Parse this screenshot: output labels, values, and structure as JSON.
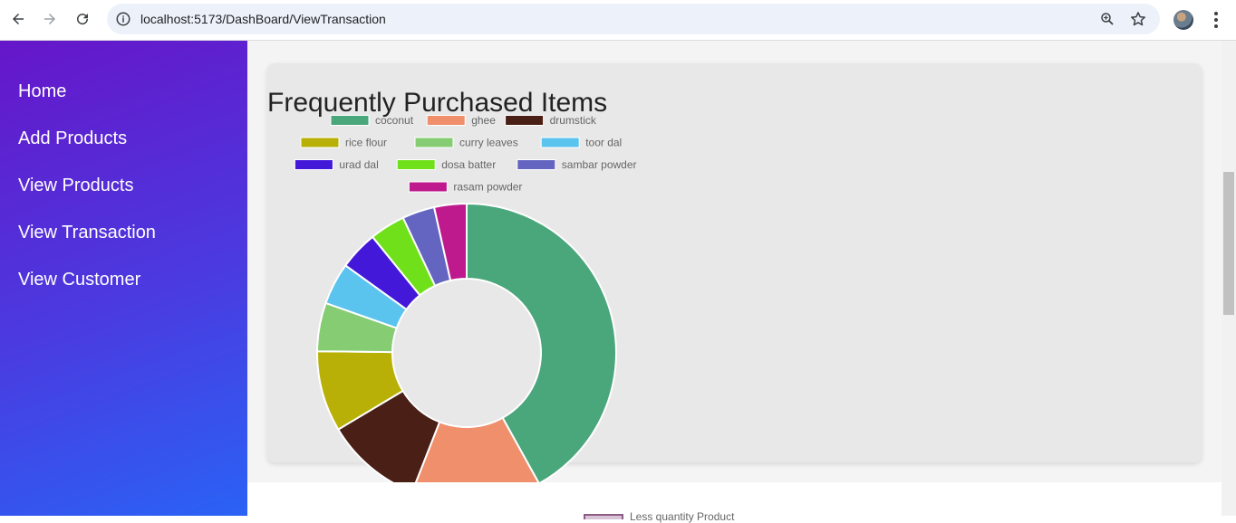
{
  "browser": {
    "url": "localhost:5173/DashBoard/ViewTransaction",
    "icons": [
      "back-icon",
      "forward-icon",
      "reload-icon",
      "info-icon",
      "zoom-icon",
      "star-icon",
      "profile-avatar",
      "menu-icon"
    ]
  },
  "sidebar": {
    "items": [
      {
        "label": "Home"
      },
      {
        "label": "Add Products"
      },
      {
        "label": "View Products"
      },
      {
        "label": "View Transaction"
      },
      {
        "label": "View Customer"
      }
    ]
  },
  "main": {
    "card_title": "Frequently Purchased Items",
    "lower_legend_label": "Less quantity Product"
  },
  "chart_data": {
    "type": "pie",
    "variant": "doughnut",
    "title": "Frequently Purchased Items",
    "legend_position": "top",
    "categories": [
      "coconut",
      "ghee",
      "drumstick",
      "rice flour",
      "curry leaves",
      "toor dal",
      "urad dal",
      "dosa batter",
      "sambar powder",
      "rasam powder"
    ],
    "values": [
      12,
      4,
      3,
      2.5,
      1.5,
      1.3,
      1.2,
      1.1,
      1,
      1
    ],
    "colors": [
      "#4aa67b",
      "#ef8f6b",
      "#4a1f16",
      "#b8b007",
      "#86cc73",
      "#5bc4ee",
      "#4318d9",
      "#6fe01a",
      "#6465c1",
      "#be1a8e"
    ]
  }
}
